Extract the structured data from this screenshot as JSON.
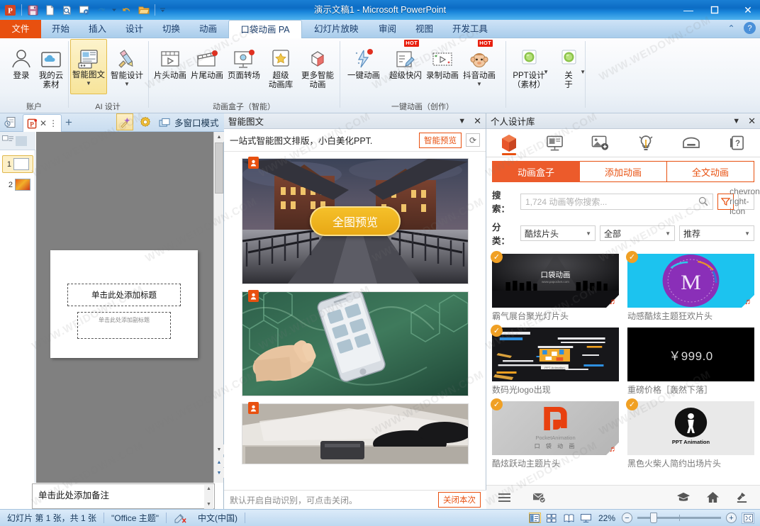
{
  "window": {
    "title": "演示文稿1  -  Microsoft PowerPoint",
    "minimize": "—",
    "maximize": "❐",
    "close": "✕",
    "help": "?",
    "collapse_ribbon": "⌃"
  },
  "quick_access": {
    "app_icon": "P",
    "items": [
      {
        "name": "save-icon",
        "glyph": "💾"
      },
      {
        "name": "new-file-icon",
        "glyph": "🗋"
      },
      {
        "name": "print-preview-icon",
        "glyph": "🔍"
      },
      {
        "name": "slideshow-icon",
        "glyph": "▣"
      },
      {
        "name": "undo-icon",
        "glyph": "↺"
      },
      {
        "name": "undo-dropdown-icon",
        "glyph": "▾"
      },
      {
        "name": "redo-icon",
        "glyph": "↻"
      },
      {
        "name": "open-folder-icon",
        "glyph": "📂"
      },
      {
        "name": "customize-qat-icon",
        "glyph": "▾"
      }
    ]
  },
  "ribbon_tabs": [
    {
      "label": "文件",
      "style": "file"
    },
    {
      "label": "开始",
      "style": "normal"
    },
    {
      "label": "插入",
      "style": "normal"
    },
    {
      "label": "设计",
      "style": "normal"
    },
    {
      "label": "切换",
      "style": "normal"
    },
    {
      "label": "动画",
      "style": "normal"
    },
    {
      "label": "口袋动画 PA",
      "style": "active"
    },
    {
      "label": "幻灯片放映",
      "style": "normal"
    },
    {
      "label": "审阅",
      "style": "normal"
    },
    {
      "label": "视图",
      "style": "normal"
    },
    {
      "label": "开发工具",
      "style": "normal"
    }
  ],
  "ribbon_groups": [
    {
      "name": "账户",
      "items": [
        {
          "label": "登录",
          "icon": "person-icon",
          "selected": false,
          "dropdown": false
        },
        {
          "label": "我的云\n素材",
          "icon": "cloud-folder-icon",
          "selected": false,
          "dropdown": false
        }
      ]
    },
    {
      "name": "AI 设计",
      "items": [
        {
          "label": "智能图文",
          "icon": "smart-graphic-text-icon",
          "selected": true,
          "dropdown": true
        },
        {
          "label": "智能设计",
          "icon": "smart-design-icon",
          "selected": false,
          "dropdown": true
        }
      ]
    },
    {
      "name": "动画盒子（智能）",
      "items": [
        {
          "label": "片头动画",
          "icon": "opening-animation-icon",
          "selected": false,
          "dropdown": false
        },
        {
          "label": "片尾动画",
          "icon": "ending-animation-icon",
          "selected": false,
          "dropdown": false,
          "dot": true
        },
        {
          "label": "页面转场",
          "icon": "page-transition-icon",
          "selected": false,
          "dropdown": false,
          "dot": true
        },
        {
          "label": "超级\n动画库",
          "icon": "super-animation-library-icon",
          "selected": false,
          "dropdown": false
        },
        {
          "label": "更多智能\n动画",
          "icon": "more-smart-animation-icon",
          "selected": false,
          "dropdown": false
        }
      ]
    },
    {
      "name": "一键动画（创作）",
      "items": [
        {
          "label": "一键动画",
          "icon": "one-click-animation-icon",
          "selected": false,
          "dropdown": false,
          "dot": true
        },
        {
          "label": "超级快闪",
          "icon": "super-flash-icon",
          "selected": false,
          "dropdown": false,
          "badge": "HOT"
        },
        {
          "label": "录制动画",
          "icon": "record-animation-icon",
          "selected": false,
          "dropdown": false
        },
        {
          "label": "抖音动画",
          "icon": "douyin-animation-icon",
          "selected": false,
          "dropdown": true,
          "badge": "HOT"
        }
      ]
    },
    {
      "name": "",
      "items": [
        {
          "label": "PPT设计\n（素材）",
          "icon": "ppt-design-icon",
          "selected": false,
          "dropdown": true
        },
        {
          "label": "关\n于",
          "icon": "about-icon",
          "selected": false,
          "dropdown": true
        }
      ]
    }
  ],
  "plugin_toolbar": {
    "recent_icon": "recent-docs-icon",
    "doc_tab": {
      "icon": "ppt-doc-icon",
      "close": "✕",
      "more": "⋮"
    },
    "add_tab": "+",
    "magic_icon": "magic-wand-icon",
    "settings_icon": "gear-icon",
    "multiwindow": {
      "icon": "window-icon",
      "label": "多窗口模式"
    }
  },
  "slide_panel": {
    "outline_icon": "outline-view-icon",
    "slides": [
      {
        "number": "1",
        "selected": true
      },
      {
        "number": "2",
        "selected": false
      }
    ],
    "scroll": {
      "up": "▲",
      "down": "▼",
      "prev": "▲",
      "next": "▼"
    }
  },
  "slide_canvas": {
    "title_placeholder": "单击此处添加标题",
    "subtitle_placeholder": "单击此处添加副标题"
  },
  "notes": {
    "placeholder": "单击此处添加备注"
  },
  "middle_panel": {
    "title": "智能图文",
    "collapse_icon": "chevron-down-icon",
    "close_icon": "close-icon",
    "subtitle": "一站式智能图文排版，小白美化PPT.",
    "preview_button": "智能预览",
    "refresh_icon": "refresh-icon",
    "cards": [
      {
        "name": "bridge-building-card",
        "overlay": "全图预览",
        "badge_icon": "person-badge-icon"
      },
      {
        "name": "phone-hexagon-card",
        "overlay": "",
        "badge_icon": "person-badge-icon"
      },
      {
        "name": "shoes-wallet-card",
        "overlay": "",
        "badge_icon": "person-badge-icon"
      }
    ],
    "footer_text": "默认开启自动识别，可点击关闭。",
    "footer_button": "关闭本次"
  },
  "right_panel": {
    "title": "个人设计库",
    "collapse_icon": "chevron-down-icon",
    "close_icon": "close-icon",
    "icon_bar": [
      {
        "name": "animation-box-icon",
        "active": true
      },
      {
        "name": "presentation-icon",
        "active": false
      },
      {
        "name": "image-add-icon",
        "active": false
      },
      {
        "name": "idea-bulb-icon",
        "active": false
      },
      {
        "name": "save-disk-icon",
        "active": false
      },
      {
        "name": "help-question-icon",
        "active": false
      }
    ],
    "tabs": [
      {
        "label": "动画盒子",
        "active": true
      },
      {
        "label": "添加动画",
        "active": false
      },
      {
        "label": "全文动画",
        "active": false
      }
    ],
    "search": {
      "label": "搜索：",
      "placeholder": "1,724 动画等你搜索...",
      "search_icon": "search-icon",
      "filter_icon": "filter-icon",
      "next_icon": "chevron-right-icon"
    },
    "category": {
      "label": "分类：",
      "selects": [
        "酷炫片头",
        "全部",
        "推荐"
      ]
    },
    "items": [
      {
        "caption": "霸气展台聚光灯片头",
        "verified": true,
        "music": true,
        "thumb": "stage-spotlight",
        "thumb_text": "口袋动画",
        "thumb_sub": "www.papocket.com"
      },
      {
        "caption": "动感酷炫主题狂欢片头",
        "verified": true,
        "music": true,
        "thumb": "purple-m-logo",
        "thumb_text": "M",
        "thumb_sub": ""
      },
      {
        "caption": "数码光logo出现",
        "verified": true,
        "music": false,
        "thumb": "digital-glitch",
        "thumb_text": "",
        "thumb_sub": ""
      },
      {
        "caption": "重磅价格［轰然下落］",
        "verified": false,
        "music": false,
        "thumb": "price-black",
        "thumb_text": "￥999.0",
        "thumb_sub": ""
      },
      {
        "caption": "酷炫跃动主题片头",
        "verified": true,
        "music": true,
        "thumb": "pocket-logo-gray",
        "thumb_text": "PocketAnimation",
        "thumb_sub": "口  袋  动  画"
      },
      {
        "caption": "黑色火柴人简约出场片头",
        "verified": true,
        "music": false,
        "thumb": "stickman-black",
        "thumb_text": "PPT Animation",
        "thumb_sub": ""
      }
    ],
    "footer": [
      {
        "name": "menu-icon",
        "side": "left"
      },
      {
        "name": "message-icon",
        "side": "left"
      },
      {
        "name": "graduation-cap-icon",
        "side": "right"
      },
      {
        "name": "home-icon",
        "side": "right"
      },
      {
        "name": "upload-icon",
        "side": "right"
      }
    ]
  },
  "status_bar": {
    "slide_info": "幻灯片 第 1 张，共 1 张",
    "theme": "\"Office 主题\"",
    "spellcheck_icon": "spellcheck-icon",
    "language": "中文(中国)",
    "views": [
      {
        "name": "normal-view-icon",
        "active": true
      },
      {
        "name": "slide-sorter-icon",
        "active": false
      },
      {
        "name": "reading-view-icon",
        "active": false
      },
      {
        "name": "slideshow-view-icon",
        "active": false
      }
    ],
    "zoom_level": "22%",
    "zoom_out": "−",
    "zoom_in": "+",
    "fit_window_icon": "fit-to-window-icon"
  },
  "watermark": {
    "text": "WWW.WEIDOWN.COM"
  }
}
